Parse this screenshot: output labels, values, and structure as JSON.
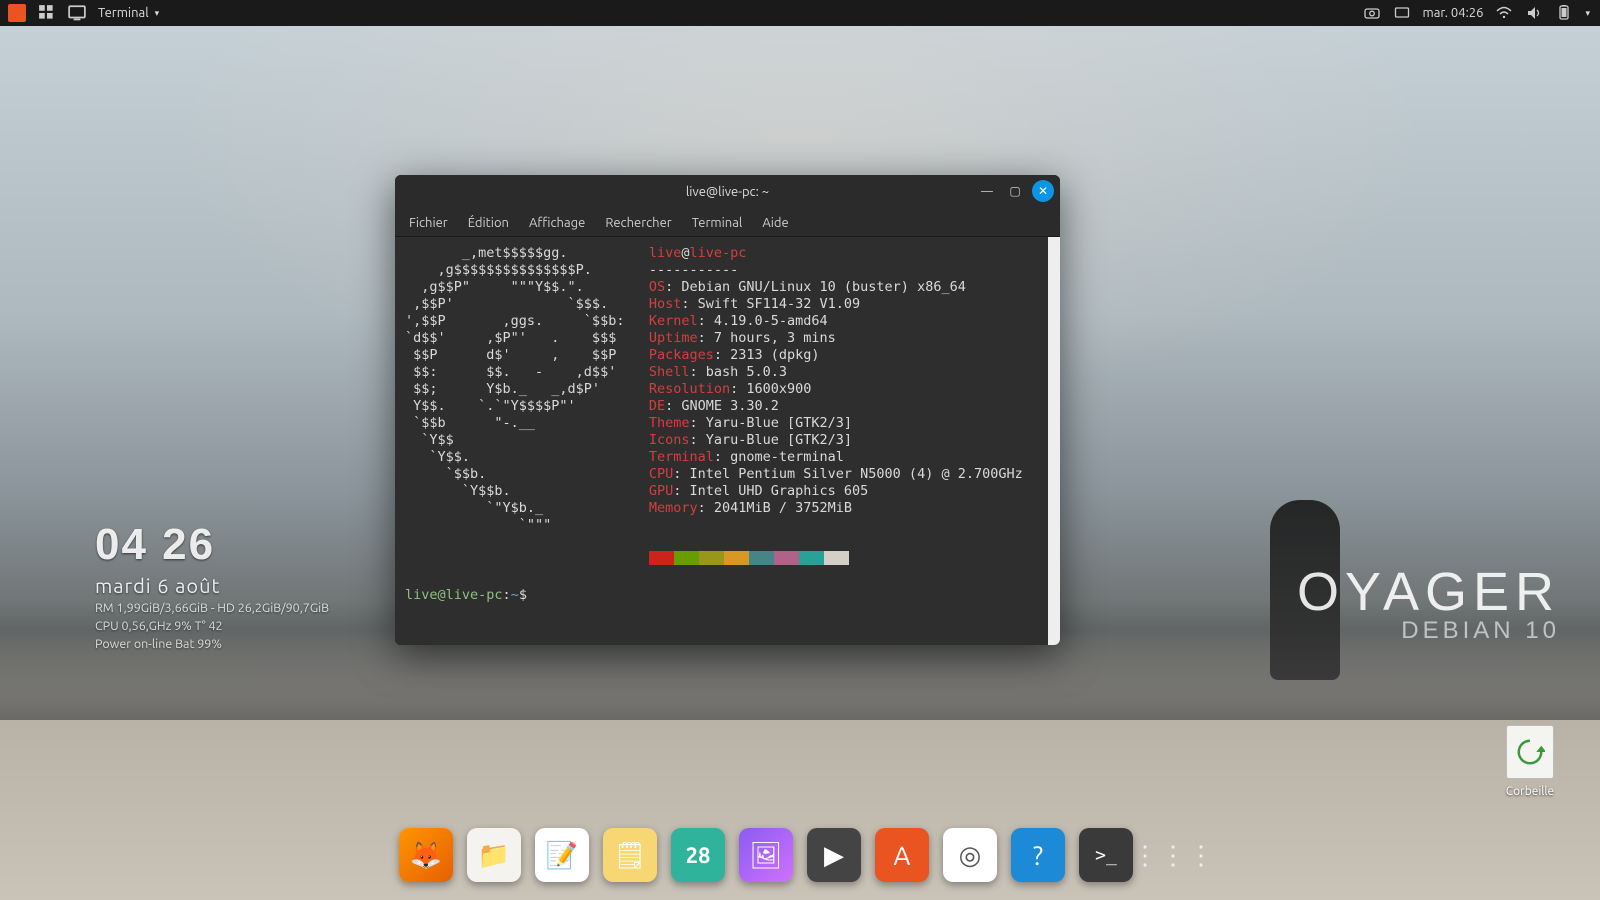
{
  "topbar": {
    "app_label": "Terminal",
    "clock": "mar. 04:26"
  },
  "conky": {
    "time": "04 26",
    "date": "mardi  6 août",
    "line1": "RM 1,99GiB/3,66GiB - HD 26,2GiB/90,7GiB",
    "line2": "CPU 0,56,GHz 9% T° 42",
    "line3": "Power on-line Bat 99%"
  },
  "voyager": {
    "big": "OYAGER",
    "sub": "DEBIAN 10"
  },
  "trash": {
    "label": "Corbeille"
  },
  "terminal": {
    "title": "live@live-pc: ~",
    "menu": [
      "Fichier",
      "Édition",
      "Affichage",
      "Rechercher",
      "Terminal",
      "Aide"
    ],
    "userhost": {
      "user": "live",
      "at": "@",
      "host": "live-pc"
    },
    "divider": "-----------",
    "info": [
      {
        "k": "OS",
        "v": "Debian GNU/Linux 10 (buster) x86_64"
      },
      {
        "k": "Host",
        "v": "Swift SF114-32 V1.09"
      },
      {
        "k": "Kernel",
        "v": "4.19.0-5-amd64"
      },
      {
        "k": "Uptime",
        "v": "7 hours, 3 mins"
      },
      {
        "k": "Packages",
        "v": "2313 (dpkg)"
      },
      {
        "k": "Shell",
        "v": "bash 5.0.3"
      },
      {
        "k": "Resolution",
        "v": "1600x900"
      },
      {
        "k": "DE",
        "v": "GNOME 3.30.2"
      },
      {
        "k": "Theme",
        "v": "Yaru-Blue [GTK2/3]"
      },
      {
        "k": "Icons",
        "v": "Yaru-Blue [GTK2/3]"
      },
      {
        "k": "Terminal",
        "v": "gnome-terminal"
      },
      {
        "k": "CPU",
        "v": "Intel Pentium Silver N5000 (4) @ 2.700GHz"
      },
      {
        "k": "GPU",
        "v": "Intel UHD Graphics 605"
      },
      {
        "k": "Memory",
        "v": "2041MiB / 3752MiB"
      }
    ],
    "ascii": [
      "       _,met$$$$$gg.          ",
      "    ,g$$$$$$$$$$$$$$$P.       ",
      "  ,g$$P\"     \"\"\"Y$$.\".        ",
      " ,$$P'              `$$$.     ",
      "',$$P       ,ggs.     `$$b:   ",
      "`d$$'     ,$P\"'   .    $$$    ",
      " $$P      d$'     ,    $$P    ",
      " $$:      $$.   -    ,d$$'    ",
      " $$;      Y$b._   _,d$P'      ",
      " Y$$.    `.`\"Y$$$$P\"'         ",
      " `$$b      \"-.__              ",
      "  `Y$$                        ",
      "   `Y$$.                      ",
      "     `$$b.                    ",
      "       `Y$$b.                 ",
      "          `\"Y$b._             ",
      "              `\"\"\"            "
    ],
    "prompt": {
      "user": "live@live-pc",
      "path": "~",
      "sym": "$"
    },
    "colors": [
      "#cc241d",
      "#689d00",
      "#98971a",
      "#d79921",
      "#458588",
      "#b16286",
      "#2aa198",
      "#d5d0c6"
    ]
  },
  "dock": {
    "items": [
      {
        "name": "firefox",
        "bg": "linear-gradient(135deg,#ff9500,#e66000)",
        "glyph": "🦊"
      },
      {
        "name": "files",
        "bg": "#f5f3ef",
        "glyph": "📁"
      },
      {
        "name": "text-editor",
        "bg": "#ffffff",
        "glyph": "📝"
      },
      {
        "name": "notes",
        "bg": "#f7d774",
        "glyph": "🗒"
      },
      {
        "name": "calendar",
        "bg": "#2fb39b",
        "glyph": "28"
      },
      {
        "name": "image-viewer",
        "bg": "linear-gradient(135deg,#8a5cf0,#d070ff)",
        "glyph": "🖼"
      },
      {
        "name": "video",
        "bg": "#444",
        "glyph": "▶"
      },
      {
        "name": "software",
        "bg": "#e95420",
        "glyph": "A"
      },
      {
        "name": "clock",
        "bg": "#fff",
        "glyph": "◎"
      },
      {
        "name": "help",
        "bg": "#1c8ad6",
        "glyph": "?"
      },
      {
        "name": "terminal",
        "bg": "#3a3a3a",
        "glyph": ">_"
      },
      {
        "name": "apps",
        "bg": "transparent",
        "glyph": "⋮⋮⋮"
      }
    ]
  }
}
